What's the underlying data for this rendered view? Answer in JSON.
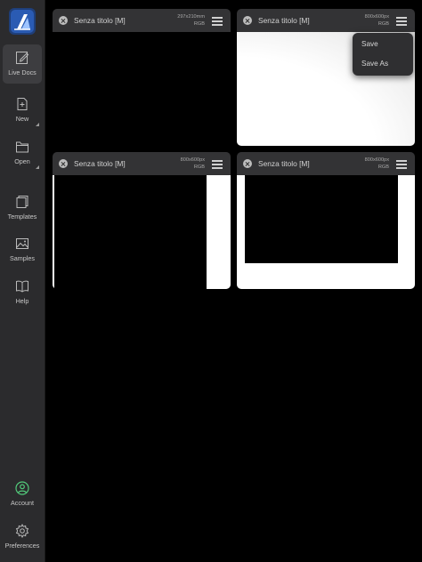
{
  "sidebar": {
    "items": [
      {
        "label": "Live Docs",
        "icon": "edit-document-icon"
      },
      {
        "label": "New",
        "icon": "new-document-icon"
      },
      {
        "label": "Open",
        "icon": "folder-icon"
      },
      {
        "label": "Templates",
        "icon": "templates-icon"
      },
      {
        "label": "Samples",
        "icon": "image-icon"
      },
      {
        "label": "Help",
        "icon": "book-icon"
      },
      {
        "label": "Account",
        "icon": "user-circle-icon"
      },
      {
        "label": "Preferences",
        "icon": "gear-icon"
      }
    ]
  },
  "documents": [
    {
      "title": "Senza titolo [M]",
      "size": "297x210mm",
      "color_mode": "RGB"
    },
    {
      "title": "Senza titolo [M]",
      "size": "800x600px",
      "color_mode": "RGB"
    },
    {
      "title": "Senza titolo [M]",
      "size": "800x600px",
      "color_mode": "RGB"
    },
    {
      "title": "Senza titolo [M]",
      "size": "800x600px",
      "color_mode": "RGB"
    }
  ],
  "popup_menu": {
    "items": [
      "Save",
      "Save As"
    ]
  },
  "colors": {
    "accent": "#52c97a",
    "sidebar_bg": "#2b2b2d",
    "header_bg": "#333335"
  }
}
